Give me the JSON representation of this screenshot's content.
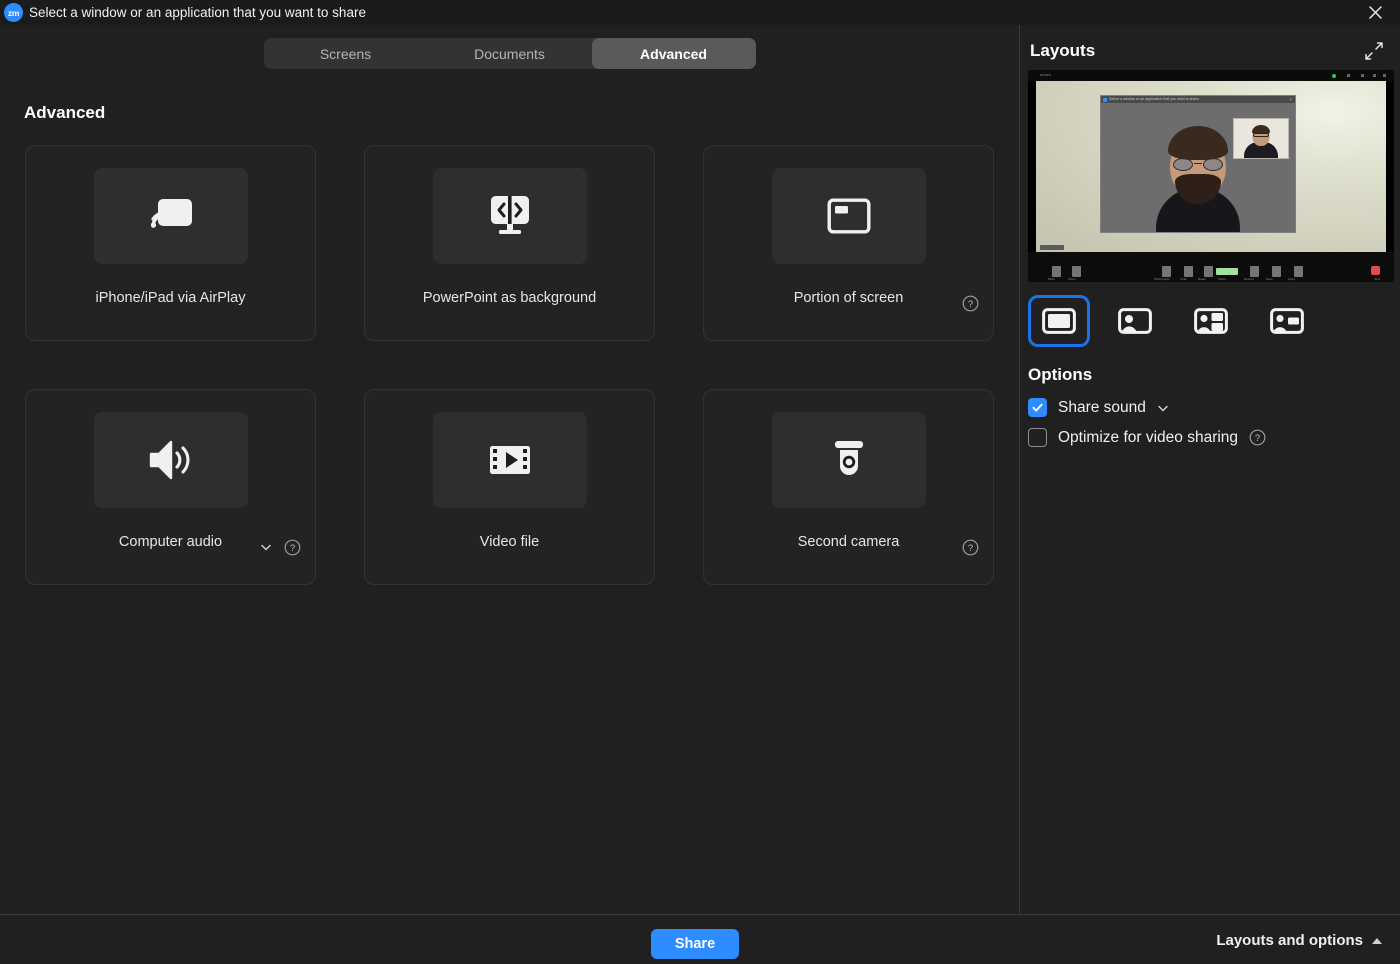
{
  "window": {
    "title": "Select a window or an application that you want to share",
    "logo_text": "zm",
    "close_icon": "close-icon"
  },
  "tabs": [
    {
      "label": "Screens",
      "active": false
    },
    {
      "label": "Documents",
      "active": false
    },
    {
      "label": "Advanced",
      "active": true
    }
  ],
  "main": {
    "section_heading": "Advanced",
    "cards": [
      {
        "label": "iPhone/iPad via AirPlay",
        "icon": "airplay-icon",
        "help": false,
        "chevron": false
      },
      {
        "label": "PowerPoint as background",
        "icon": "powerpoint-monitor-icon",
        "help": false,
        "chevron": false
      },
      {
        "label": "Portion of screen",
        "icon": "portion-of-screen-icon",
        "help": true,
        "chevron": false
      },
      {
        "label": "Computer audio",
        "icon": "speaker-icon",
        "help": true,
        "chevron": true
      },
      {
        "label": "Video file",
        "icon": "film-play-icon",
        "help": false,
        "chevron": false
      },
      {
        "label": "Second camera",
        "icon": "security-camera-icon",
        "help": true,
        "chevron": false
      }
    ]
  },
  "right_panel": {
    "layouts_title": "Layouts",
    "expand_icon": "expand-diagonal-icon",
    "preview": {
      "window_title": "Select a window or an application that you want to share",
      "alt": "Shared screen preview showing a seated person on video against a light wall with a picture-in-picture self view"
    },
    "layout_buttons": [
      {
        "name": "layout-screen-only",
        "selected": true
      },
      {
        "name": "layout-person-left",
        "selected": false
      },
      {
        "name": "layout-person-with-content",
        "selected": false
      },
      {
        "name": "layout-person-with-badge",
        "selected": false
      }
    ],
    "options_title": "Options",
    "options": [
      {
        "label": "Share sound",
        "checked": true,
        "chevron": true,
        "help": false
      },
      {
        "label": "Optimize for video sharing",
        "checked": false,
        "chevron": false,
        "help": true
      }
    ]
  },
  "footer": {
    "share_label": "Share",
    "layouts_and_options_label": "Layouts and options",
    "caret": "caret-up-icon"
  },
  "colors": {
    "accent_blue": "#2d8cff",
    "selection_ring": "#1a73e8",
    "window_bg": "#202020",
    "titlebar_bg": "#1b1b1b",
    "card_bg": "#232323",
    "icon_tile_bg": "#2e2e2e",
    "tabbar_bg": "#333333",
    "tab_active_bg": "#5a5a5a"
  }
}
